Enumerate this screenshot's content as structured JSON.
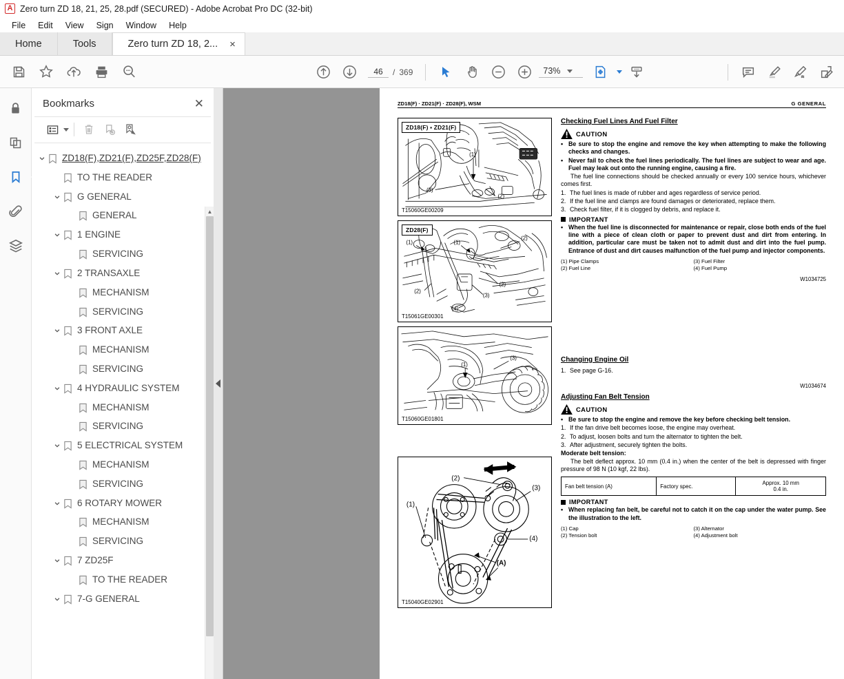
{
  "window": {
    "title": "Zero turn ZD 18, 21, 25, 28.pdf (SECURED) - Adobe Acrobat Pro DC (32-bit)",
    "logo_letter": "A"
  },
  "menubar": {
    "items": [
      {
        "label": "File"
      },
      {
        "label": "Edit"
      },
      {
        "label": "View"
      },
      {
        "label": "Sign"
      },
      {
        "label": "Window"
      },
      {
        "label": "Help"
      }
    ]
  },
  "tabs": [
    {
      "label": "Home"
    },
    {
      "label": "Tools"
    },
    {
      "label": "Zero turn ZD 18, 2...",
      "close": "×"
    }
  ],
  "toolbar": {
    "left_tools": [
      {
        "name": "save-icon"
      },
      {
        "name": "star-icon"
      },
      {
        "name": "cloud-upload-icon"
      },
      {
        "name": "print-icon"
      },
      {
        "name": "zoom-search-icon"
      }
    ],
    "page_up_label": "previous-page",
    "page_down_label": "next-page",
    "current_page": "46",
    "page_separator": "/",
    "total_pages": "369",
    "zoom_level": "73%",
    "right_tools": [
      {
        "name": "comment-icon"
      },
      {
        "name": "highlight-icon"
      },
      {
        "name": "sign-icon"
      },
      {
        "name": "fill-and-sign-icon"
      }
    ]
  },
  "rail": {
    "items": [
      {
        "name": "lock-icon",
        "active": false
      },
      {
        "name": "page-thumbnails-icon",
        "active": false
      },
      {
        "name": "bookmarks-icon",
        "active": true
      },
      {
        "name": "attachments-icon",
        "active": false
      },
      {
        "name": "layers-icon",
        "active": false
      }
    ]
  },
  "bookmarks_panel": {
    "title": "Bookmarks",
    "close_label": "✕",
    "toolbar": [
      {
        "name": "options-list-icon"
      },
      {
        "name": "delete-bookmark-icon"
      },
      {
        "name": "new-bookmark-icon"
      },
      {
        "name": "find-bookmark-icon"
      }
    ],
    "tree": [
      {
        "label": "ZD18(F),ZD21(F),ZD25F,ZD28(F)",
        "depth": 0,
        "expanded": true,
        "root": true
      },
      {
        "label": "TO THE READER",
        "depth": 1,
        "expanded": null,
        "root": false
      },
      {
        "label": "G GENERAL",
        "depth": 1,
        "expanded": true,
        "root": false
      },
      {
        "label": "GENERAL",
        "depth": 2,
        "expanded": null,
        "root": false
      },
      {
        "label": "1 ENGINE",
        "depth": 1,
        "expanded": true,
        "root": false
      },
      {
        "label": "SERVICING",
        "depth": 2,
        "expanded": null,
        "root": false
      },
      {
        "label": "2 TRANSAXLE",
        "depth": 1,
        "expanded": true,
        "root": false
      },
      {
        "label": "MECHANISM",
        "depth": 2,
        "expanded": null,
        "root": false
      },
      {
        "label": "SERVICING",
        "depth": 2,
        "expanded": null,
        "root": false
      },
      {
        "label": "3 FRONT AXLE",
        "depth": 1,
        "expanded": true,
        "root": false
      },
      {
        "label": "MECHANISM",
        "depth": 2,
        "expanded": null,
        "root": false
      },
      {
        "label": "SERVICING",
        "depth": 2,
        "expanded": null,
        "root": false
      },
      {
        "label": "4 HYDRAULIC SYSTEM",
        "depth": 1,
        "expanded": true,
        "root": false
      },
      {
        "label": "MECHANISM",
        "depth": 2,
        "expanded": null,
        "root": false
      },
      {
        "label": "SERVICING",
        "depth": 2,
        "expanded": null,
        "root": false
      },
      {
        "label": "5 ELECTRICAL SYSTEM",
        "depth": 1,
        "expanded": true,
        "root": false
      },
      {
        "label": "MECHANISM",
        "depth": 2,
        "expanded": null,
        "root": false
      },
      {
        "label": "SERVICING",
        "depth": 2,
        "expanded": null,
        "root": false
      },
      {
        "label": "6 ROTARY MOWER",
        "depth": 1,
        "expanded": true,
        "root": false
      },
      {
        "label": "MECHANISM",
        "depth": 2,
        "expanded": null,
        "root": false
      },
      {
        "label": "SERVICING",
        "depth": 2,
        "expanded": null,
        "root": false
      },
      {
        "label": "7 ZD25F",
        "depth": 1,
        "expanded": true,
        "root": false
      },
      {
        "label": "TO THE READER",
        "depth": 2,
        "expanded": null,
        "root": false
      },
      {
        "label": "7-G GENERAL",
        "depth": 1,
        "expanded": true,
        "root": false
      }
    ]
  },
  "document": {
    "header_left": "ZD18(F) · ZD21(F) · ZD28(F), WSM",
    "header_right": "G  GENERAL",
    "figures": [
      {
        "tag": "ZD18(F) ▪ ZD21(F)",
        "code": "T15060GE00209"
      },
      {
        "tag": "ZD28(F)",
        "code": "T15061GE00301"
      },
      {
        "tag": "",
        "code": "T15060GE01801"
      },
      {
        "tag": "",
        "code": "T15040GE02901"
      }
    ],
    "section1": {
      "title": "Checking Fuel Lines And Fuel Filter",
      "caution_label": "CAUTION",
      "caution_bullets": [
        "Be sure to stop the engine and remove the key when attempting to make the following checks and changes.",
        "Never fail to check the fuel lines periodically.  The fuel lines are subject to wear and age.  Fuel may leak out onto the running engine, causing a fire."
      ],
      "intro": "The fuel line connections should be checked annually or every 100 service hours, whichever comes first.",
      "steps": [
        "The fuel lines is made of rubber and ages regardless of service period.",
        "If the fuel line and clamps are found damages or deteriorated, replace them.",
        "Check fuel filter, if it is clogged by debris, and replace it."
      ],
      "important_label": "IMPORTANT",
      "important_bullets": [
        "When the fuel line is disconnected for maintenance or repair, close both ends of the fuel line with a piece of clean cloth or paper to prevent dust and dirt from entering.  In addition, particular care must be taken not to admit dust and dirt into the fuel pump.  Entrance of dust and dirt causes malfunction of the fuel pump and injector components."
      ],
      "legend_left": [
        "(1)  Pipe Clamps",
        "(2)  Fuel Line"
      ],
      "legend_right": [
        "(3)  Fuel Filter",
        "(4)  Fuel Pump"
      ],
      "wcode": "W1034725"
    },
    "section2": {
      "title": "Changing Engine Oil",
      "steps": [
        "See page G-16."
      ],
      "wcode": "W1034674"
    },
    "section3": {
      "title": "Adjusting Fan Belt Tension",
      "caution_label": "CAUTION",
      "caution_bullets": [
        "Be sure to stop the engine and remove the key before checking belt tension."
      ],
      "steps": [
        "If the fan drive belt becomes loose, the engine may overheat.",
        "To adjust, loosen bolts and turn the alternator to tighten the belt.",
        "After adjustment, securely tighten the bolts."
      ],
      "moderate_label": "Moderate belt tension:",
      "moderate_text": "The belt deflect approx. 10 mm (0.4 in.) when the center of the belt is depressed with finger pressure of 98 N (10 kgf, 22 lbs).",
      "table": {
        "cell1": "Fan belt tension (A)",
        "cell2": "Factory spec.",
        "cell3_line1": "Approx. 10 mm",
        "cell3_line2": "0.4 in."
      },
      "important_label": "IMPORTANT",
      "important_bullets": [
        "When replacing fan belt, be careful not to catch it on the cap under the water pump.  See the illustration to the left."
      ],
      "legend_left": [
        "(1)  Cap",
        "(2)  Tension bolt"
      ],
      "legend_right": [
        "(3)  Alternator",
        "(4)  Adjustment bolt"
      ]
    }
  },
  "colors": {
    "accent_blue": "#2b7cd3",
    "acrobat_red": "#d32b2b",
    "viewer_gray": "#949494"
  }
}
